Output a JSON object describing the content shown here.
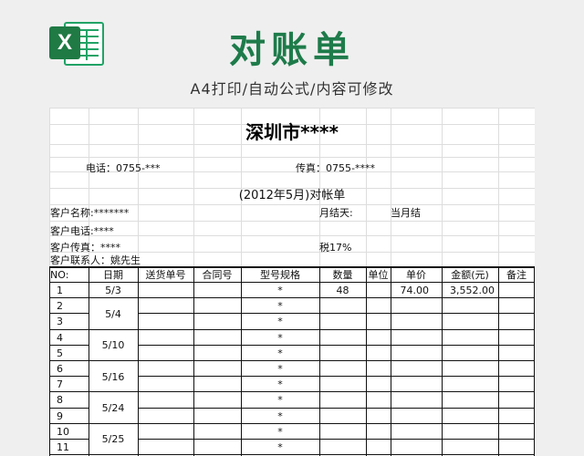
{
  "header": {
    "title": "对账单",
    "subtitle": "A4打印/自动公式/内容可修改",
    "logo_letter": "X"
  },
  "sheet": {
    "company": "深圳市****",
    "phone": "电话：0755-***",
    "fax": "传真：0755-****",
    "statement_title": "(2012年5月)对帐单",
    "customer_name": "客户名称:*******",
    "month_end_label": "月结天:",
    "month_end_value": "当月结",
    "customer_phone": "客户电话:****",
    "customer_fax": "客户传真：****",
    "tax": "税17%",
    "customer_contact": "客户联系人：姚先生",
    "columns": [
      "NO:",
      "日期",
      "送货单号",
      "合同号",
      "型号规格",
      "数量",
      "单位",
      "单价",
      "金额(元)",
      "备注"
    ],
    "rows": [
      {
        "no": "1",
        "model": "*",
        "qty": "48",
        "price": "74.00",
        "amount": "3,552.00"
      },
      {
        "no": "2",
        "model": "*",
        "qty": "",
        "price": "",
        "amount": ""
      },
      {
        "no": "3",
        "model": "*",
        "qty": "",
        "price": "",
        "amount": ""
      },
      {
        "no": "4",
        "model": "*",
        "qty": "",
        "price": "",
        "amount": ""
      },
      {
        "no": "5",
        "model": "*",
        "qty": "",
        "price": "",
        "amount": ""
      },
      {
        "no": "6",
        "model": "*",
        "qty": "",
        "price": "",
        "amount": ""
      },
      {
        "no": "7",
        "model": "*",
        "qty": "",
        "price": "",
        "amount": ""
      },
      {
        "no": "8",
        "model": "*",
        "qty": "",
        "price": "",
        "amount": ""
      },
      {
        "no": "9",
        "model": "*",
        "qty": "",
        "price": "",
        "amount": ""
      },
      {
        "no": "10",
        "model": "*",
        "qty": "",
        "price": "",
        "amount": ""
      },
      {
        "no": "11",
        "model": "*",
        "qty": "",
        "price": "",
        "amount": ""
      }
    ],
    "dates": [
      "5/3",
      "5/4",
      "5/10",
      "5/16",
      "5/24",
      "5/25"
    ]
  }
}
